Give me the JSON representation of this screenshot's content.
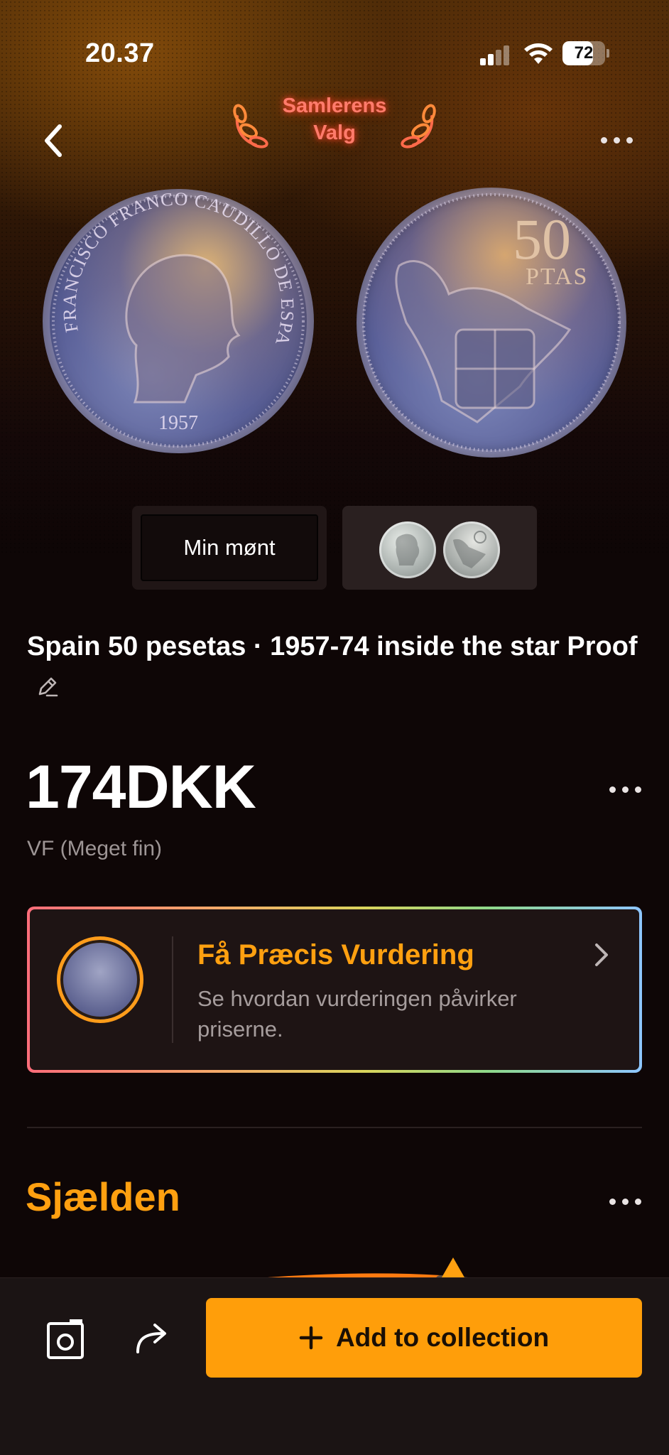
{
  "status_bar": {
    "time": "20.37",
    "battery": "72",
    "battery_level": 0.72
  },
  "header": {
    "badge_line1": "Samlerens",
    "badge_line2": "Valg",
    "back_icon": "chevron-left-icon",
    "more_icon": "more-horizontal-icon"
  },
  "coin_images": {
    "obverse_legend": "FRANCISCO FRANCO CAUDILLO DE ESPAÑA POR LA G.DE DIOS",
    "obverse_year": "1957",
    "reverse_value": "50",
    "reverse_unit": "PTAS"
  },
  "view_switch": {
    "my_coin_label": "Min mønt"
  },
  "coin": {
    "title": "Spain 50 pesetas · 1957-74 inside the star Proof",
    "price": "174DKK",
    "grade": "VF (Meget fin)"
  },
  "appraisal_card": {
    "title": "Få Præcis Vurdering",
    "subtitle": "Se hvordan vurderingen påvirker priserne."
  },
  "rarity": {
    "heading": "Sjælden"
  },
  "bottom_bar": {
    "add_label": "Add to collection"
  },
  "colors": {
    "accent": "#ff9e0a",
    "background": "#0e0606",
    "badge_glow": "#ff7b6b"
  }
}
